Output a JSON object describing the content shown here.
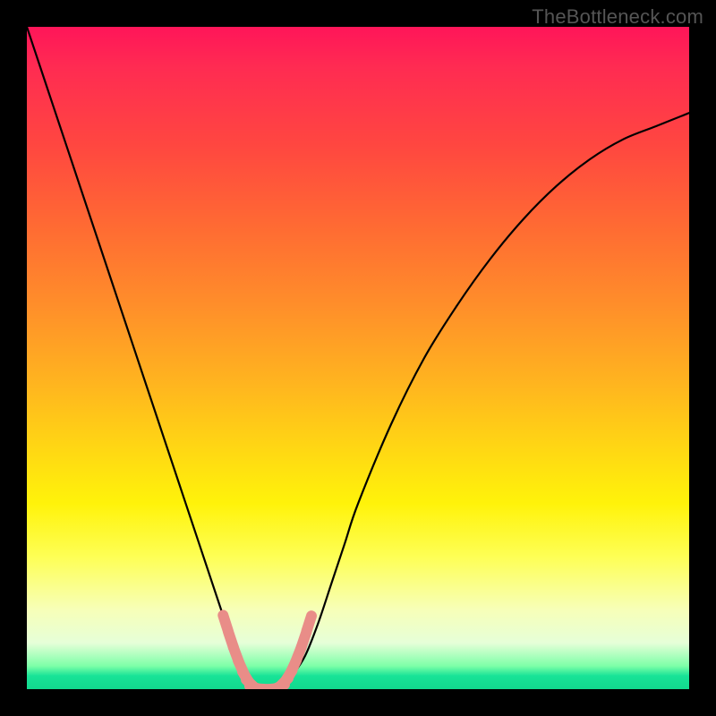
{
  "watermark": "TheBottleneck.com",
  "chart_data": {
    "type": "line",
    "title": "",
    "xlabel": "",
    "ylabel": "",
    "xlim": [
      0,
      100
    ],
    "ylim": [
      0,
      100
    ],
    "x": [
      0,
      2,
      4,
      6,
      8,
      10,
      12,
      14,
      16,
      18,
      20,
      22,
      24,
      26,
      28,
      30,
      31,
      32,
      33,
      34,
      35,
      36,
      37,
      38,
      39,
      40,
      42,
      44,
      46,
      48,
      50,
      55,
      60,
      65,
      70,
      75,
      80,
      85,
      90,
      95,
      100
    ],
    "series": [
      {
        "name": "bottleneck-curve",
        "values": [
          100,
          94,
          88,
          82,
          76,
          70,
          64,
          58,
          52,
          46,
          40,
          34,
          28,
          22,
          16,
          10,
          7,
          4,
          2,
          1,
          0.2,
          0,
          0,
          0.3,
          1,
          2,
          5,
          10,
          16,
          22,
          28,
          40,
          50,
          58,
          65,
          71,
          76,
          80,
          83,
          85,
          87
        ]
      }
    ],
    "valley_markers": {
      "name": "current-config-band",
      "x_start": 30,
      "x_end": 42,
      "segments": [
        {
          "x": 30.0,
          "y": 10.0
        },
        {
          "x": 30.8,
          "y": 7.5
        },
        {
          "x": 31.6,
          "y": 5.2
        },
        {
          "x": 32.4,
          "y": 3.2
        },
        {
          "x": 33.2,
          "y": 1.6
        },
        {
          "x": 34.0,
          "y": 0.6
        },
        {
          "x": 34.8,
          "y": 0.1
        },
        {
          "x": 35.8,
          "y": 0.0
        },
        {
          "x": 36.8,
          "y": 0.0
        },
        {
          "x": 37.8,
          "y": 0.2
        },
        {
          "x": 38.6,
          "y": 0.8
        },
        {
          "x": 39.4,
          "y": 1.8
        },
        {
          "x": 40.2,
          "y": 3.3
        },
        {
          "x": 41.0,
          "y": 5.2
        },
        {
          "x": 41.8,
          "y": 7.4
        },
        {
          "x": 42.6,
          "y": 9.9
        }
      ]
    },
    "gradient_stops": [
      {
        "pct": 0,
        "color": "#ff1559"
      },
      {
        "pct": 30,
        "color": "#ff6a33"
      },
      {
        "pct": 64,
        "color": "#ffd813"
      },
      {
        "pct": 88,
        "color": "#f7ffb8"
      },
      {
        "pct": 98,
        "color": "#18e397"
      },
      {
        "pct": 100,
        "color": "#12d98e"
      }
    ]
  }
}
